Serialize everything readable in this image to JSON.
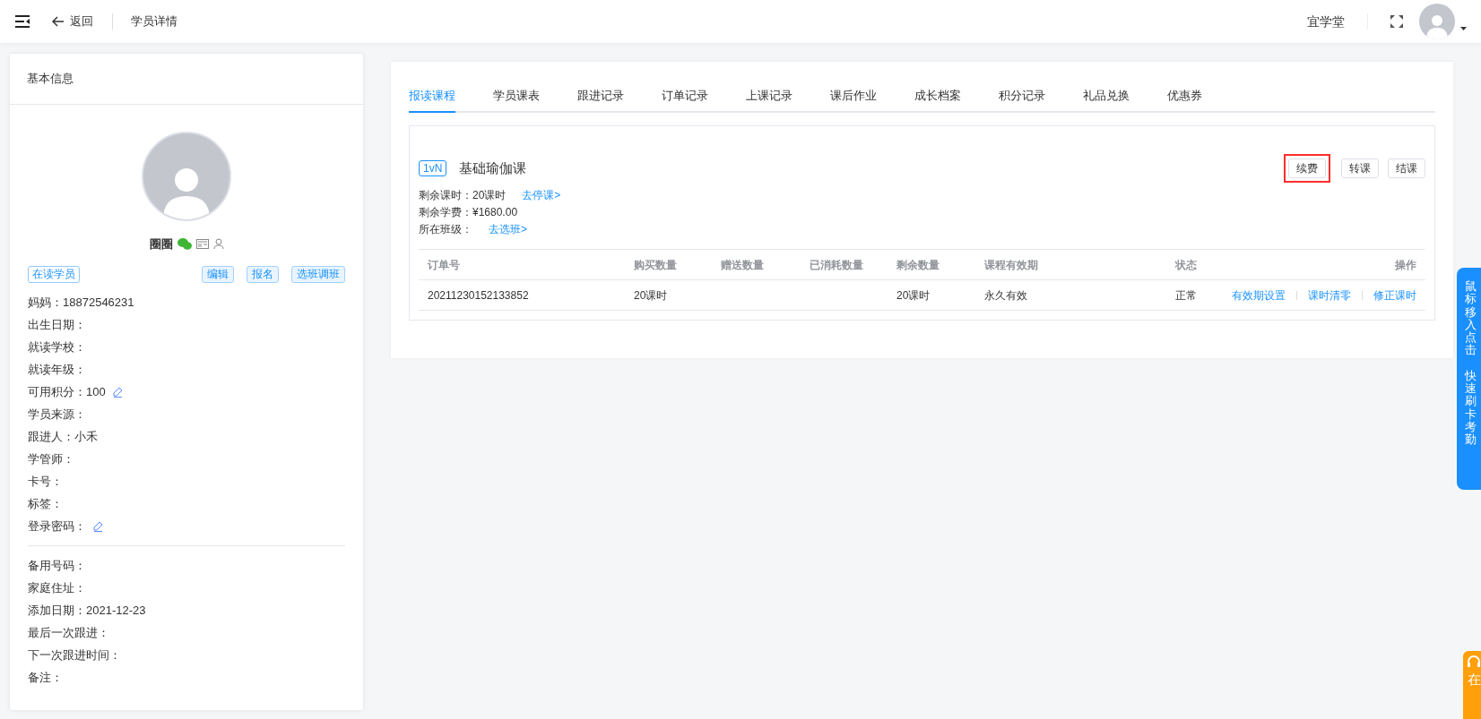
{
  "topbar": {
    "back": "返回",
    "page_title": "学员详情",
    "org_name": "宜学堂"
  },
  "basic_info": {
    "title": "基本信息",
    "student_name": "圈圈",
    "status_tag": "在读学员",
    "actions": [
      "编辑",
      "报名",
      "选班调班"
    ],
    "fields": [
      {
        "label": "妈妈：",
        "value": "18872546231",
        "editable": false
      },
      {
        "label": "出生日期：",
        "editable": false
      },
      {
        "label": "就读学校：",
        "editable": false
      },
      {
        "label": "就读年级：",
        "editable": false
      },
      {
        "label": "可用积分：",
        "value": "100",
        "editable": true
      },
      {
        "label": "学员来源：",
        "editable": false
      },
      {
        "label": "跟进人：",
        "value": "小禾",
        "editable": false
      },
      {
        "label": "学管师：",
        "editable": false
      },
      {
        "label": "卡号：",
        "editable": false
      },
      {
        "label": "标签：",
        "editable": false
      },
      {
        "label": "登录密码：",
        "editable": true
      }
    ],
    "extra_fields": [
      {
        "label": "备用号码："
      },
      {
        "label": "家庭住址："
      },
      {
        "label": "添加日期：",
        "value": "2021-12-23"
      },
      {
        "label": "最后一次跟进："
      },
      {
        "label": "下一次跟进时间："
      },
      {
        "label": "备注："
      }
    ]
  },
  "tabs": [
    {
      "label": "报读课程",
      "selected": true
    },
    {
      "label": "学员课表",
      "selected": false
    },
    {
      "label": "跟进记录",
      "selected": false
    },
    {
      "label": "订单记录",
      "selected": false
    },
    {
      "label": "上课记录",
      "selected": false
    },
    {
      "label": "课后作业",
      "selected": false
    },
    {
      "label": "成长档案",
      "selected": false
    },
    {
      "label": "积分记录",
      "selected": false
    },
    {
      "label": "礼品兑换",
      "selected": false
    },
    {
      "label": "优惠券",
      "selected": false
    }
  ],
  "course": {
    "type_tag": "1vN",
    "name": "基础瑜伽课",
    "buttons": [
      {
        "label": "续费",
        "highlighted": true
      },
      {
        "label": "转课",
        "highlighted": false
      },
      {
        "label": "结课",
        "highlighted": false
      }
    ],
    "details": [
      {
        "text": "剩余课时：20课时",
        "link": "去停课>"
      },
      {
        "text": "剩余学费：¥1680.00"
      },
      {
        "text": "所在班级：",
        "link": "去选班>"
      }
    ],
    "table": {
      "columns": [
        "订单号",
        "购买数量",
        "赠送数量",
        "已消耗数量",
        "剩余数量",
        "课程有效期",
        "状态",
        "操作"
      ],
      "rows": [
        {
          "cells": [
            "20211230152133852",
            "20课时",
            "",
            "",
            "20课时",
            "永久有效",
            "正常"
          ],
          "actions": [
            "有效期设置",
            "课时清零",
            "修正课时"
          ]
        }
      ]
    }
  },
  "side_tab": {
    "lines": [
      "鼠标移入点击",
      "快速刷卡考勤"
    ]
  },
  "online_tab": {
    "text": "在"
  }
}
